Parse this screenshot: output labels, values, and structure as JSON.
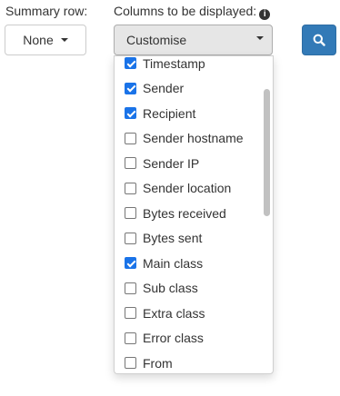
{
  "summary_row": {
    "label": "Summary row:",
    "button_label": "None"
  },
  "columns": {
    "label": "Columns to be displayed:",
    "button_label": "Customise",
    "info_icon": "info-icon",
    "options": [
      {
        "label": "Timestamp",
        "checked": true
      },
      {
        "label": "Sender",
        "checked": true
      },
      {
        "label": "Recipient",
        "checked": true
      },
      {
        "label": "Sender hostname",
        "checked": false
      },
      {
        "label": "Sender IP",
        "checked": false
      },
      {
        "label": "Sender location",
        "checked": false
      },
      {
        "label": "Bytes received",
        "checked": false
      },
      {
        "label": "Bytes sent",
        "checked": false
      },
      {
        "label": "Main class",
        "checked": true
      },
      {
        "label": "Sub class",
        "checked": false
      },
      {
        "label": "Extra class",
        "checked": false
      },
      {
        "label": "Error class",
        "checked": false
      },
      {
        "label": "From",
        "checked": false
      }
    ]
  },
  "search_button": {
    "icon": "search-icon",
    "color": "#337ab7"
  },
  "colors": {
    "checkbox_checked": "#1a73e8",
    "dropdown_button_active": "#e6e6e6"
  }
}
